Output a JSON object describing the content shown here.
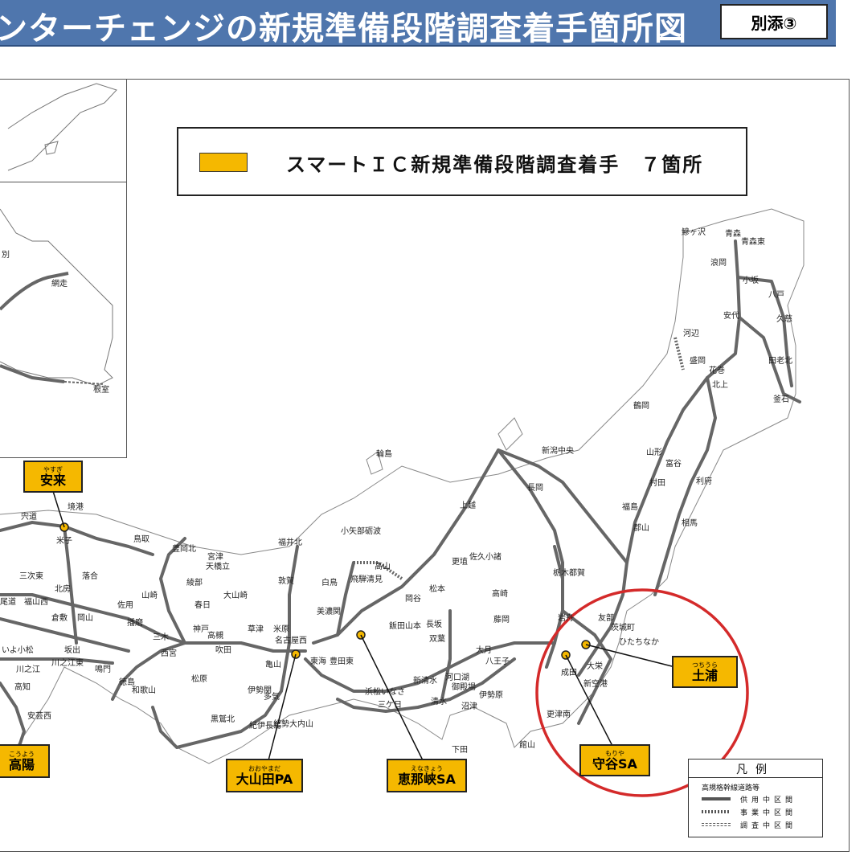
{
  "header": {
    "title": "ンターチェンジの新規準備段階調査着手箇所図",
    "annex": "別添③"
  },
  "map_heading": {
    "text": "スマートＩＣ新規準備段階調査着手　７箇所",
    "swatch_color": "#f5b800"
  },
  "callouts": [
    {
      "ruby": "やすぎ",
      "name": "安来"
    },
    {
      "ruby": "こうよう",
      "name": "高陽"
    },
    {
      "ruby": "おおやまだ",
      "name": "大山田PA"
    },
    {
      "ruby": "えなきょう",
      "name": "恵那峡SA"
    },
    {
      "ruby": "もりや",
      "name": "守谷SA"
    },
    {
      "ruby": "つちうら",
      "name": "土浦"
    }
  ],
  "legend": {
    "title": "凡例",
    "subtitle": "高規格幹線道路等",
    "rows": [
      "供用中区間",
      "事業中区間",
      "調査中区間"
    ]
  },
  "highlight_color": "#d42a2a",
  "road_color": "#666666",
  "city_labels": [
    "鰺ヶ沢",
    "青森",
    "青森東",
    "浪岡",
    "小坂",
    "八戸",
    "安代",
    "久慈",
    "河辺",
    "盛岡",
    "田老北",
    "花巻",
    "北上",
    "釜石",
    "鶴岡",
    "山形",
    "村田",
    "富谷",
    "利府",
    "新潟中央",
    "長岡",
    "福島",
    "相馬",
    "郡山",
    "栃木都賀",
    "岩舟",
    "友部",
    "茨城町",
    "ひたちなか",
    "大栄",
    "新空港",
    "成田",
    "更津南",
    "館山",
    "上越",
    "更埴",
    "佐久小諸",
    "高崎",
    "藤岡",
    "松本",
    "岡谷",
    "長坂",
    "双葉",
    "大月",
    "八王子",
    "河口湖",
    "御殿場",
    "伊勢原",
    "沼津",
    "清水",
    "下田",
    "新清水",
    "三ケ日",
    "浜松いなさ",
    "飯田山本",
    "高山",
    "飛騨清見",
    "小矢部砺波",
    "輪島",
    "福井北",
    "白鳥",
    "美濃関",
    "敦賀",
    "草津",
    "米原",
    "名古屋西",
    "東海",
    "豊田東",
    "亀山",
    "伊勢関",
    "紀勢大内山",
    "紀伊長島",
    "多気",
    "黒鷲北",
    "和歌山",
    "松原",
    "神戸",
    "高槻",
    "大山崎",
    "吹田",
    "春日",
    "綾部",
    "宮津",
    "天橋立",
    "豊岡北",
    "鳥取",
    "西宮",
    "米子",
    "境港",
    "落合",
    "佐用",
    "山崎",
    "播磨",
    "三木",
    "倉敷",
    "岡山",
    "北房",
    "三次東",
    "福山西",
    "尾道",
    "坂出",
    "川之江東",
    "鳴門",
    "徳島",
    "高知",
    "安芸西",
    "いよ小松",
    "川之江",
    "宍道",
    "根室",
    "網走"
  ]
}
